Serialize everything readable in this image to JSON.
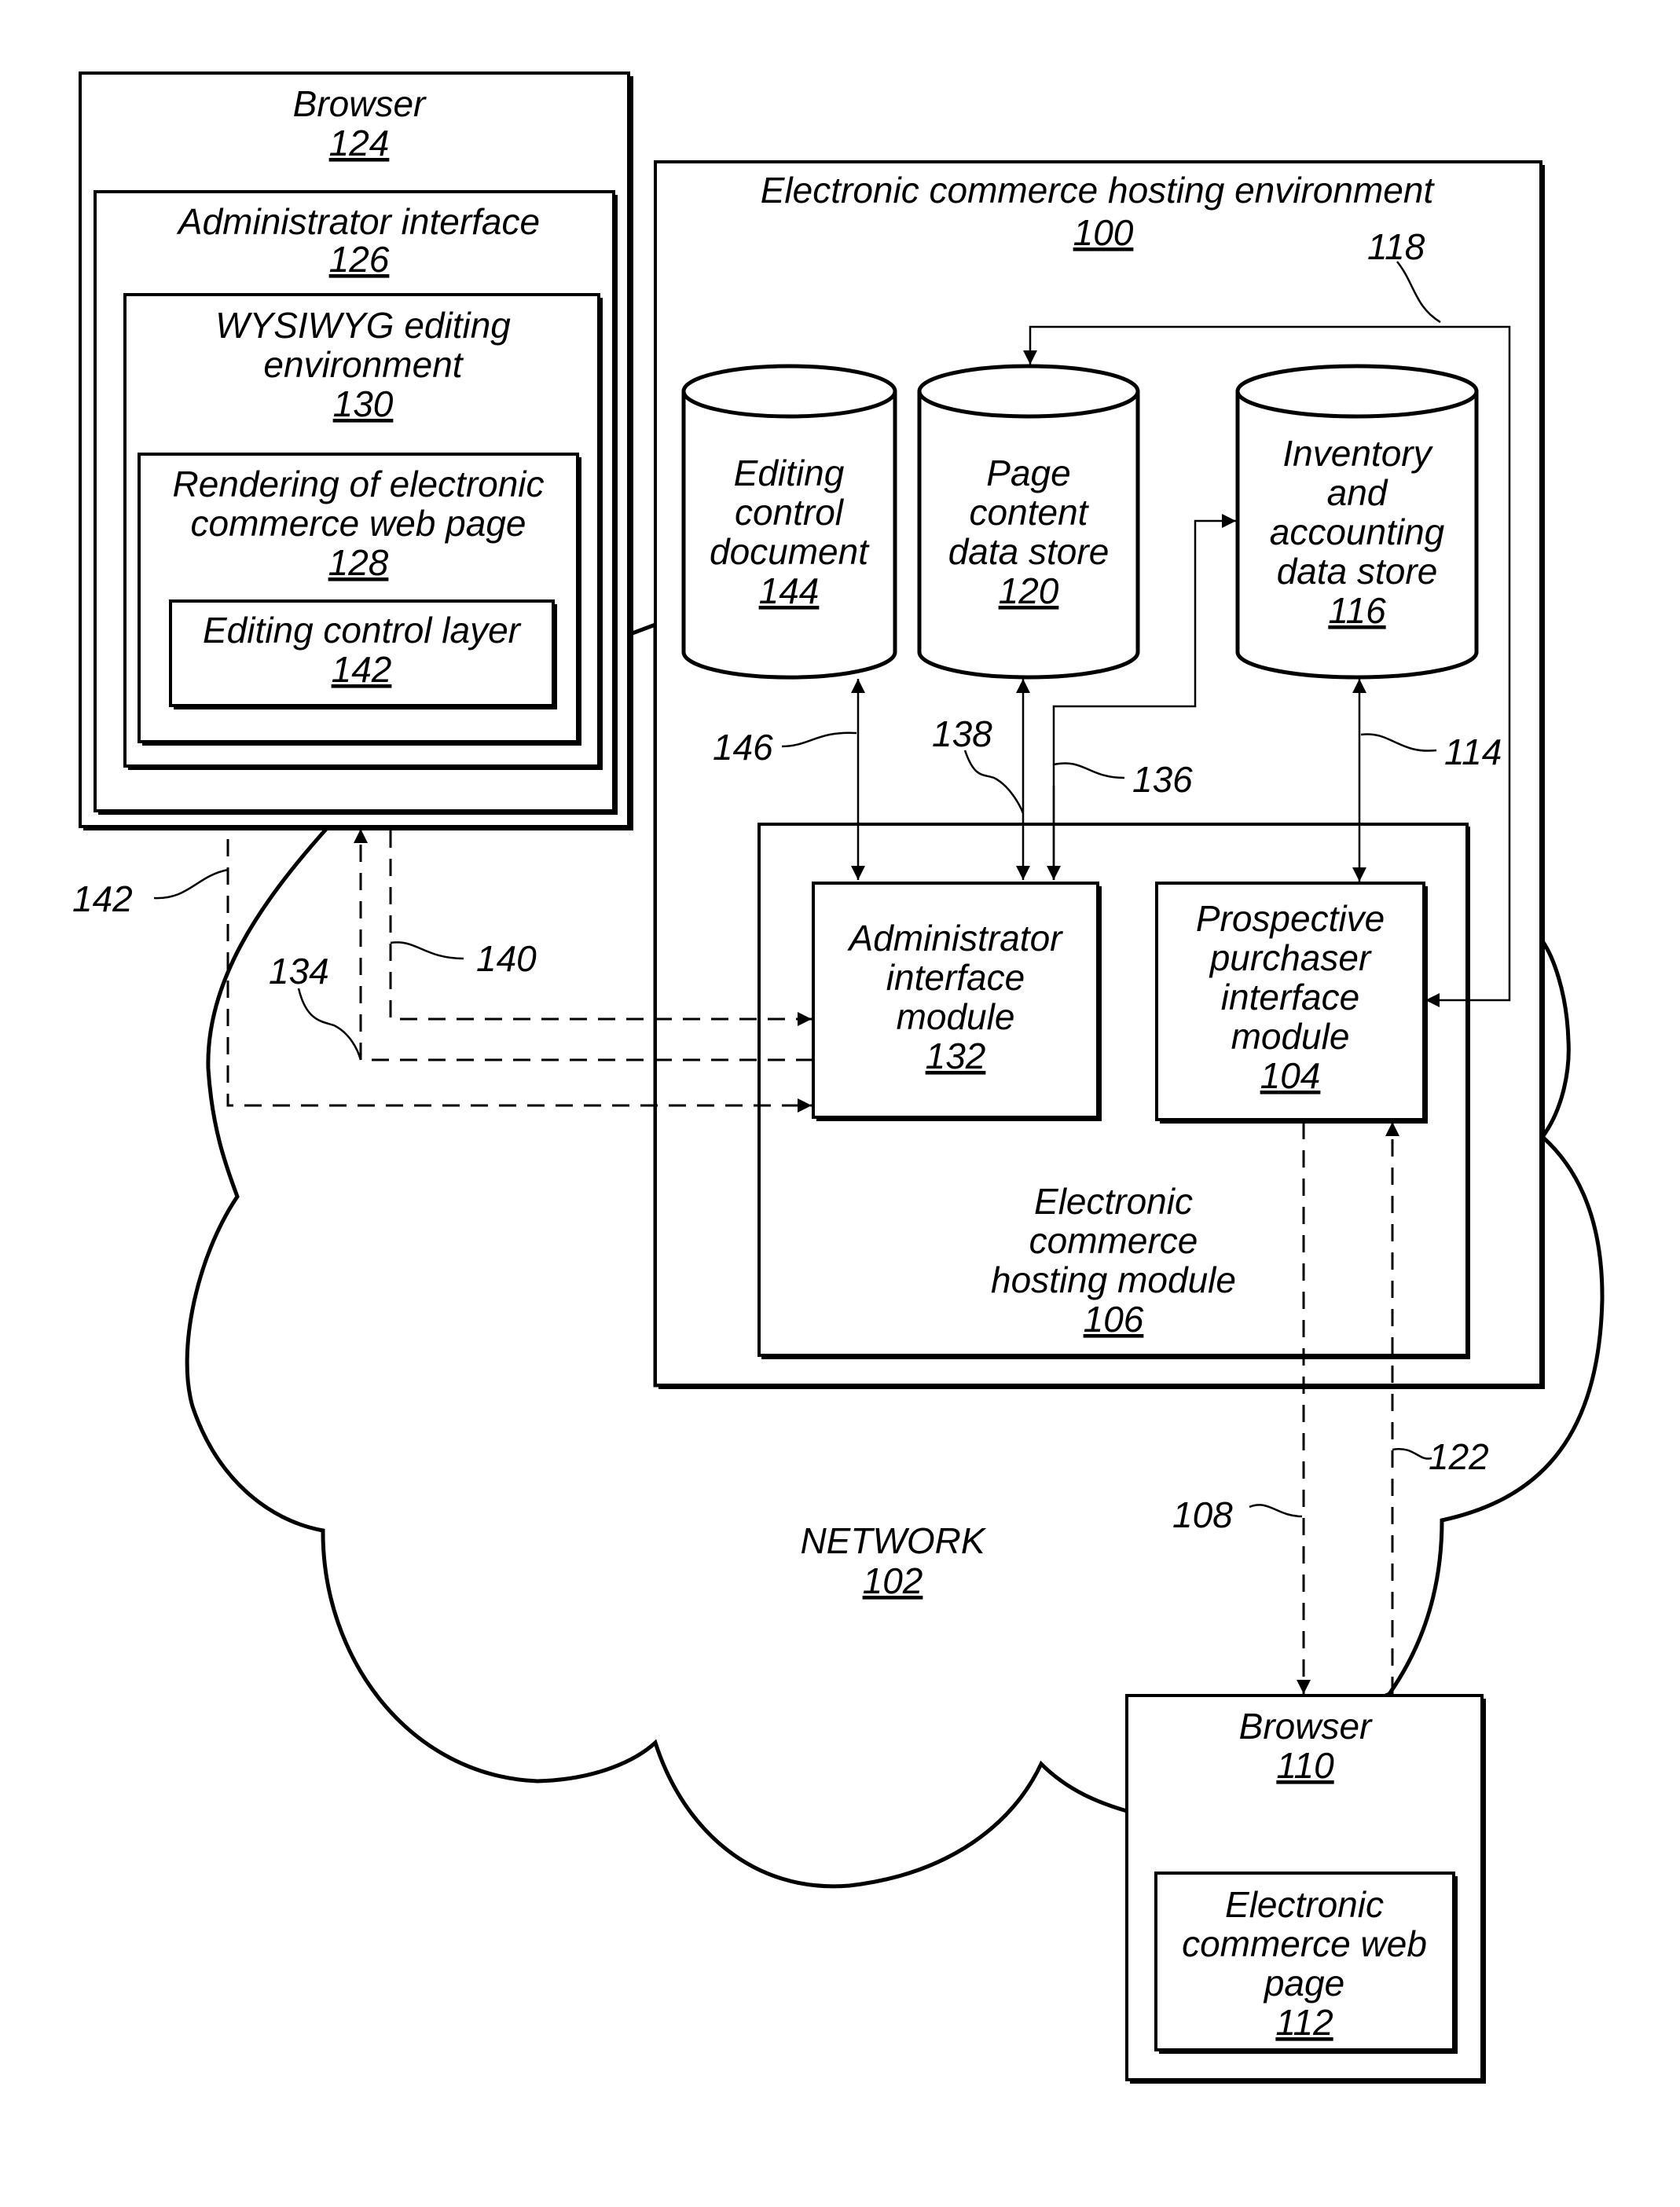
{
  "figure": {
    "network": {
      "label": "NETWORK",
      "ref": "102"
    },
    "admin_browser": {
      "label": "Browser",
      "ref": "124",
      "admin_interface": {
        "label": "Administrator interface",
        "ref": "126"
      },
      "wysiwyg": {
        "lines": [
          "WYSIWYG editing",
          "environment"
        ],
        "ref": "130"
      },
      "rendering": {
        "lines": [
          "Rendering of electronic",
          "commerce web page"
        ],
        "ref": "128"
      },
      "editing_layer": {
        "label": "Editing control layer",
        "ref": "142"
      }
    },
    "hosting_environment": {
      "label": "Electronic commerce hosting environment",
      "ref": "100",
      "editing_doc": {
        "lines": [
          "Editing",
          "control",
          "document"
        ],
        "ref": "144"
      },
      "page_content": {
        "lines": [
          "Page",
          "content",
          "data store"
        ],
        "ref": "120"
      },
      "inventory": {
        "lines": [
          "Inventory",
          "and",
          "accounting",
          "data store"
        ],
        "ref": "116"
      },
      "hosting_module": {
        "lines": [
          "Electronic",
          "commerce",
          "hosting module"
        ],
        "ref": "106",
        "admin_module": {
          "lines": [
            "Administrator",
            "interface",
            "module"
          ],
          "ref": "132"
        },
        "purchaser_module": {
          "lines": [
            "Prospective",
            "purchaser",
            "interface",
            "module"
          ],
          "ref": "104"
        }
      }
    },
    "customer_browser": {
      "label": "Browser",
      "ref": "110",
      "web_page": {
        "lines": [
          "Electronic",
          "commerce web",
          "page"
        ],
        "ref": "112"
      }
    },
    "callouts": {
      "c142": "142",
      "c134": "134",
      "c140": "140",
      "c146": "146",
      "c138": "138",
      "c136": "136",
      "c114": "114",
      "c118": "118",
      "c108": "108",
      "c122": "122"
    }
  }
}
